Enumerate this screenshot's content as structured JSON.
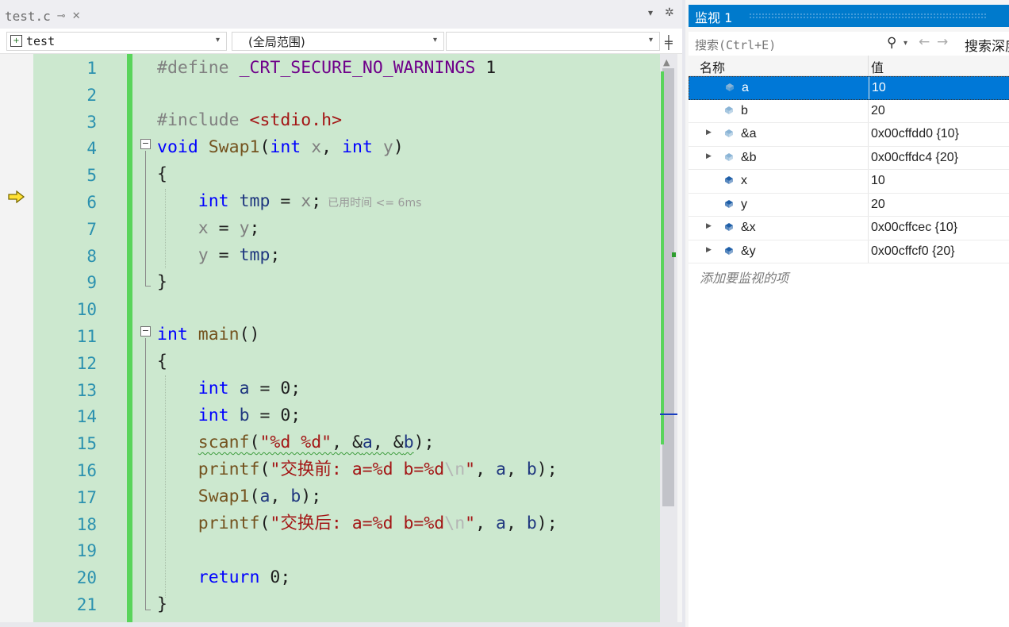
{
  "editor": {
    "tab_title": "test.c",
    "tab_pin": "⊸",
    "tab_close": "✕",
    "tab_dropdown": "▾",
    "tab_settings": "✲",
    "nav_project": "test",
    "nav_scope": "(全局范围)",
    "nav_arrow": "▾",
    "nav_split": "╪",
    "current_line": 6,
    "elapsed_time": "已用时间 <= 6ms",
    "line_numbers": [
      "1",
      "2",
      "3",
      "4",
      "5",
      "6",
      "7",
      "8",
      "9",
      "10",
      "11",
      "12",
      "13",
      "14",
      "15",
      "16",
      "17",
      "18",
      "19",
      "20",
      "21"
    ]
  },
  "watch": {
    "title": "监视 1",
    "search_placeholder": "搜索(Ctrl+E)",
    "search_depth": "搜索深度",
    "col_name": "名称",
    "col_value": "值",
    "add_item": "添加要监视的项",
    "rows": [
      {
        "name": "a",
        "value": "10",
        "expandable": false,
        "selected": true,
        "icon_color": "#8ab4d6"
      },
      {
        "name": "b",
        "value": "20",
        "expandable": false,
        "selected": false,
        "icon_color": "#8ab4d6"
      },
      {
        "name": "&a",
        "value": "0x00cffdd0 {10}",
        "expandable": true,
        "selected": false,
        "icon_color": "#8ab4d6"
      },
      {
        "name": "&b",
        "value": "0x00cffdc4 {20}",
        "expandable": true,
        "selected": false,
        "icon_color": "#8ab4d6"
      },
      {
        "name": "x",
        "value": "10",
        "expandable": false,
        "selected": false,
        "icon_color": "#1f5fa8"
      },
      {
        "name": "y",
        "value": "20",
        "expandable": false,
        "selected": false,
        "icon_color": "#1f5fa8"
      },
      {
        "name": "&x",
        "value": "0x00cffcec {10}",
        "expandable": true,
        "selected": false,
        "icon_color": "#1f5fa8"
      },
      {
        "name": "&y",
        "value": "0x00cffcf0 {20}",
        "expandable": true,
        "selected": false,
        "icon_color": "#1f5fa8"
      }
    ]
  },
  "code": {
    "l1_directive": "#define",
    "l1_macro": "_CRT_SECURE_NO_WARNINGS",
    "l1_value": "1",
    "l3_directive": "#include",
    "l3_header": "<stdio.h>",
    "l4_ret": "void",
    "l4_fn": "Swap1",
    "l4_open": "(",
    "l4_t1": "int",
    "l4_p1": "x",
    "l4_comma": ",",
    "l4_t2": "int",
    "l4_p2": "y",
    "l4_close": ")",
    "l5": "{",
    "l6_type": "int",
    "l6_var": "tmp",
    "l6_eq": " = ",
    "l6_rhs": "x",
    "l6_semi": ";",
    "l7_lhs": "x",
    "l7_eq": " = ",
    "l7_rhs": "y",
    "l7_semi": ";",
    "l8_lhs": "y",
    "l8_eq": " = ",
    "l8_rhs": "tmp",
    "l8_semi": ";",
    "l9": "}",
    "l11_type": "int",
    "l11_fn": "main",
    "l11_parens": "()",
    "l12": "{",
    "l13_type": "int",
    "l13_var": "a",
    "l13_rest": " = 0;",
    "l14_type": "int",
    "l14_var": "b",
    "l14_rest": " = 0;",
    "l15_fn": "scanf",
    "l15_open": "(",
    "l15_str": "\"%d %d\"",
    "l15_mid1": ", &",
    "l15_a": "a",
    "l15_mid2": ", &",
    "l15_b": "b",
    "l15_end": ");",
    "l16_fn": "printf",
    "l16_open": "(",
    "l16_str": "\"交换前: a=%d b=%d",
    "l16_esc": "\\n",
    "l16_str_end": "\"",
    "l16_mid": ", ",
    "l16_a": "a",
    "l16_c": ", ",
    "l16_b": "b",
    "l16_end": ");",
    "l17_fn": "Swap1",
    "l17_open": "(",
    "l17_a": "a",
    "l17_c": ", ",
    "l17_b": "b",
    "l17_end": ");",
    "l18_fn": "printf",
    "l18_open": "(",
    "l18_str": "\"交换后: a=%d b=%d",
    "l18_esc": "\\n",
    "l18_str_end": "\"",
    "l18_mid": ", ",
    "l18_a": "a",
    "l18_c": ", ",
    "l18_b": "b",
    "l18_end": ");",
    "l20_kw": "return",
    "l20_rest": " 0;",
    "l21": "}"
  }
}
